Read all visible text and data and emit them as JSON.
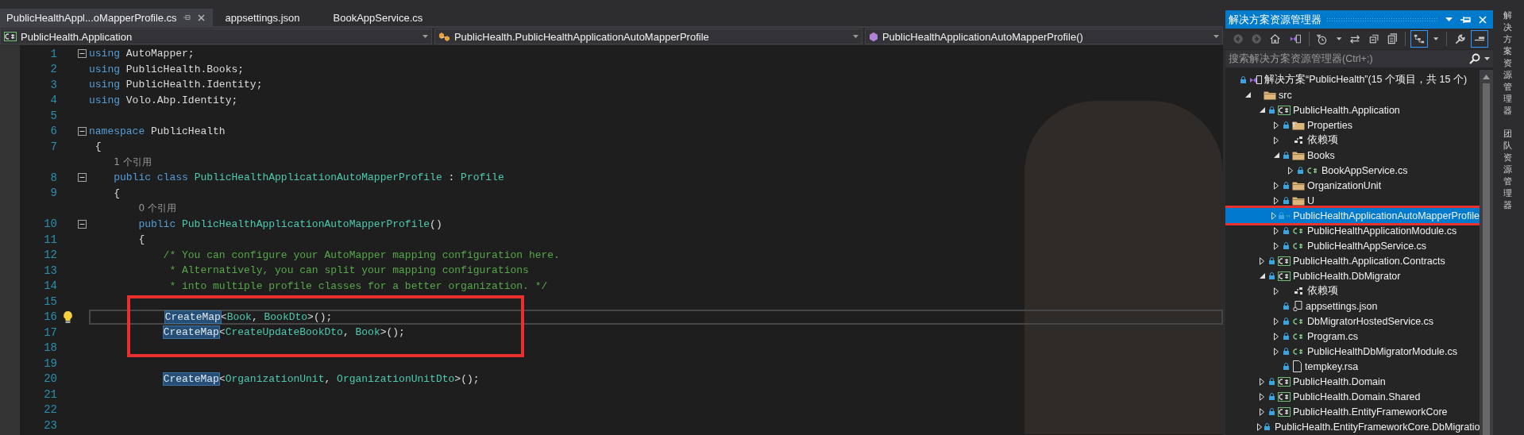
{
  "editor_tabs": [
    {
      "label": "PublicHealthAppl...oMapperProfile.cs",
      "selected": true
    },
    {
      "label": "appsettings.json",
      "selected": false
    },
    {
      "label": "BookAppService.cs",
      "selected": false
    }
  ],
  "nav_bar": [
    {
      "kind": "project",
      "label": "PublicHealth.Application"
    },
    {
      "kind": "class",
      "label": "PublicHealth.PublicHealthApplicationAutoMapperProfile"
    },
    {
      "kind": "method",
      "label": "PublicHealthApplicationAutoMapperProfile()"
    }
  ],
  "code_lines": [
    {
      "kind": "code",
      "number": "1",
      "fold": true,
      "tokens": [
        {
          "kind": "kw",
          "text": "using"
        },
        {
          "kind": "plain",
          "text": " AutoMapper;"
        }
      ]
    },
    {
      "kind": "code",
      "number": "2",
      "tokens": [
        {
          "kind": "kw",
          "text": "using"
        },
        {
          "kind": "plain",
          "text": " PublicHealth.Books;"
        }
      ]
    },
    {
      "kind": "code",
      "number": "3",
      "tokens": [
        {
          "kind": "kw",
          "text": "using"
        },
        {
          "kind": "plain",
          "text": " PublicHealth.Identity;"
        }
      ]
    },
    {
      "kind": "code",
      "number": "4",
      "tokens": [
        {
          "kind": "kw",
          "text": "using"
        },
        {
          "kind": "plain",
          "text": " Volo.Abp.Identity;"
        }
      ]
    },
    {
      "kind": "code",
      "number": "5"
    },
    {
      "kind": "code",
      "number": "6",
      "fold": true,
      "tokens": [
        {
          "kind": "kw",
          "text": "namespace"
        },
        {
          "kind": "plain",
          "text": " PublicHealth"
        }
      ]
    },
    {
      "kind": "code",
      "number": "7",
      "tokens": [
        {
          "kind": "plain",
          "text": " {"
        }
      ]
    },
    {
      "kind": "lens",
      "text": "    1 个引用"
    },
    {
      "kind": "code",
      "number": "8",
      "fold": true,
      "tokens": [
        {
          "kind": "kw",
          "text": "    public class"
        },
        {
          "kind": "type",
          "text": " PublicHealthApplicationAutoMapperProfile"
        },
        {
          "kind": "plain",
          "text": " : "
        },
        {
          "kind": "type",
          "text": "Profile"
        }
      ]
    },
    {
      "kind": "code",
      "number": "9",
      "tokens": [
        {
          "kind": "plain",
          "text": "    {"
        }
      ]
    },
    {
      "kind": "lens",
      "text": "        0 个引用"
    },
    {
      "kind": "code",
      "number": "10",
      "fold": true,
      "tokens": [
        {
          "kind": "kw",
          "text": "        public"
        },
        {
          "kind": "type",
          "text": " PublicHealthApplicationAutoMapperProfile"
        },
        {
          "kind": "plain",
          "text": "()"
        }
      ]
    },
    {
      "kind": "code",
      "number": "11",
      "tokens": [
        {
          "kind": "plain",
          "text": "        {"
        }
      ]
    },
    {
      "kind": "code",
      "number": "12",
      "tokens": [
        {
          "kind": "comment",
          "text": "            /* You can configure your AutoMapper mapping configuration here."
        }
      ]
    },
    {
      "kind": "code",
      "number": "13",
      "tokens": [
        {
          "kind": "comment",
          "text": "             * Alternatively, you can split your mapping configurations"
        }
      ]
    },
    {
      "kind": "code",
      "number": "14",
      "tokens": [
        {
          "kind": "comment",
          "text": "             * into multiple profile classes for a better organization. */"
        }
      ]
    },
    {
      "kind": "code",
      "number": "15",
      "boxed": true
    },
    {
      "kind": "code",
      "number": "16",
      "boxed": true,
      "current": true,
      "lightbulb": true,
      "tokens": [
        {
          "kind": "hl",
          "text": "            CreateMap"
        },
        {
          "kind": "plain",
          "text": "<"
        },
        {
          "kind": "type",
          "text": "Book"
        },
        {
          "kind": "plain",
          "text": ", "
        },
        {
          "kind": "type",
          "text": "BookDto"
        },
        {
          "kind": "plain",
          "text": ">();"
        }
      ]
    },
    {
      "kind": "code",
      "number": "17",
      "boxed": true,
      "tokens": [
        {
          "kind": "hl",
          "text": "            CreateMap"
        },
        {
          "kind": "plain",
          "text": "<"
        },
        {
          "kind": "type",
          "text": "CreateUpdateBookDto"
        },
        {
          "kind": "plain",
          "text": ", "
        },
        {
          "kind": "type",
          "text": "Book"
        },
        {
          "kind": "plain",
          "text": ">();"
        }
      ]
    },
    {
      "kind": "code",
      "number": "18",
      "boxed": true
    },
    {
      "kind": "code",
      "number": "19"
    },
    {
      "kind": "code",
      "number": "20",
      "tokens": [
        {
          "kind": "hl",
          "text": "            CreateMap"
        },
        {
          "kind": "plain",
          "text": "<"
        },
        {
          "kind": "type",
          "text": "OrganizationUnit"
        },
        {
          "kind": "plain",
          "text": ", "
        },
        {
          "kind": "type",
          "text": "OrganizationUnitDto"
        },
        {
          "kind": "plain",
          "text": ">();"
        }
      ]
    },
    {
      "kind": "code",
      "number": "21"
    },
    {
      "kind": "code",
      "number": "22"
    },
    {
      "kind": "code",
      "number": "23"
    }
  ],
  "solution_explorer": {
    "title": "解决方案资源管理器",
    "toolbar": [
      {
        "kind": "back",
        "disabled": true
      },
      {
        "kind": "forward",
        "disabled": true
      },
      {
        "kind": "home",
        "disabled": false
      },
      {
        "kind": "solution",
        "disabled": false
      },
      {
        "kind": "separator"
      },
      {
        "kind": "history",
        "disabled": false
      },
      {
        "kind": "dropdown",
        "disabled": false
      },
      {
        "kind": "sync",
        "disabled": false
      },
      {
        "kind": "collapse",
        "disabled": false
      },
      {
        "kind": "copy",
        "disabled": false
      },
      {
        "kind": "separator"
      },
      {
        "kind": "tree",
        "disabled": false,
        "on": true
      },
      {
        "kind": "dropdown",
        "disabled": false
      },
      {
        "kind": "separator"
      },
      {
        "kind": "wrench",
        "disabled": false
      },
      {
        "kind": "preview",
        "disabled": false,
        "on": true
      }
    ],
    "search": {
      "placeholder": "搜索解决方案资源管理器(Ctrl+;)"
    },
    "tree": [
      {
        "kind": "solution",
        "label": "解决方案“PublicHealth”(15 个项目，共 15 个)",
        "locked": true,
        "selected": false,
        "children": [
          {
            "kind": "folder",
            "label": "src",
            "locked": false,
            "expanded": true,
            "selected": false,
            "children": [
              {
                "kind": "csproj",
                "label": "PublicHealth.Application",
                "locked": true,
                "expanded": true,
                "selected": false,
                "children": [
                  {
                    "kind": "props",
                    "label": "Properties",
                    "locked": true,
                    "expanded": false,
                    "selected": false
                  },
                  {
                    "kind": "deps",
                    "label": "依赖项",
                    "locked": false,
                    "expanded": false,
                    "selected": false
                  },
                  {
                    "kind": "folder",
                    "label": "Books",
                    "locked": true,
                    "expanded": true,
                    "selected": false,
                    "children": [
                      {
                        "kind": "cs",
                        "label": "BookAppService.cs",
                        "locked": true,
                        "expanded": false,
                        "selected": false
                      }
                    ]
                  },
                  {
                    "kind": "folder",
                    "label": "OrganizationUnit",
                    "locked": true,
                    "expanded": false,
                    "selected": false
                  },
                  {
                    "kind": "folder",
                    "label": "U",
                    "locked": true,
                    "expanded": false,
                    "selected": false
                  },
                  {
                    "kind": "cs",
                    "label": "PublicHealthApplicationAutoMapperProfile",
                    "locked": true,
                    "expanded": false,
                    "selected": true,
                    "boxed": true
                  },
                  {
                    "kind": "cs",
                    "label": "PublicHealthApplicationModule.cs",
                    "locked": true,
                    "expanded": false,
                    "selected": false
                  },
                  {
                    "kind": "cs",
                    "label": "PublicHealthAppService.cs",
                    "locked": true,
                    "expanded": false,
                    "selected": false
                  }
                ]
              },
              {
                "kind": "csproj",
                "label": "PublicHealth.Application.Contracts",
                "locked": true,
                "expanded": false,
                "selected": false
              },
              {
                "kind": "csproj",
                "label": "PublicHealth.DbMigrator",
                "locked": true,
                "expanded": true,
                "selected": false,
                "children": [
                  {
                    "kind": "deps",
                    "label": "依赖项",
                    "locked": false,
                    "expanded": false,
                    "selected": false
                  },
                  {
                    "kind": "json",
                    "label": "appsettings.json",
                    "locked": true,
                    "selected": false
                  },
                  {
                    "kind": "cs",
                    "label": "DbMigratorHostedService.cs",
                    "locked": true,
                    "expanded": false,
                    "selected": false
                  },
                  {
                    "kind": "cs",
                    "label": "Program.cs",
                    "locked": true,
                    "expanded": false,
                    "selected": false
                  },
                  {
                    "kind": "cs",
                    "label": "PublicHealthDbMigratorModule.cs",
                    "locked": true,
                    "expanded": false,
                    "selected": false
                  },
                  {
                    "kind": "file",
                    "label": "tempkey.rsa",
                    "locked": true,
                    "selected": false
                  }
                ]
              },
              {
                "kind": "csproj",
                "label": "PublicHealth.Domain",
                "locked": true,
                "expanded": false,
                "selected": false
              },
              {
                "kind": "csproj",
                "label": "PublicHealth.Domain.Shared",
                "locked": true,
                "expanded": false,
                "selected": false
              },
              {
                "kind": "csproj",
                "label": "PublicHealth.EntityFrameworkCore",
                "locked": true,
                "expanded": false,
                "selected": false
              },
              {
                "kind": "csproj",
                "label": "PublicHealth.EntityFrameworkCore.DbMigratio",
                "locked": true,
                "expanded": false,
                "selected": false
              }
            ]
          }
        ]
      }
    ]
  },
  "side_tabs": [
    {
      "label": "解决方案资源管理器"
    },
    {
      "label": "团队资源管理器"
    }
  ]
}
